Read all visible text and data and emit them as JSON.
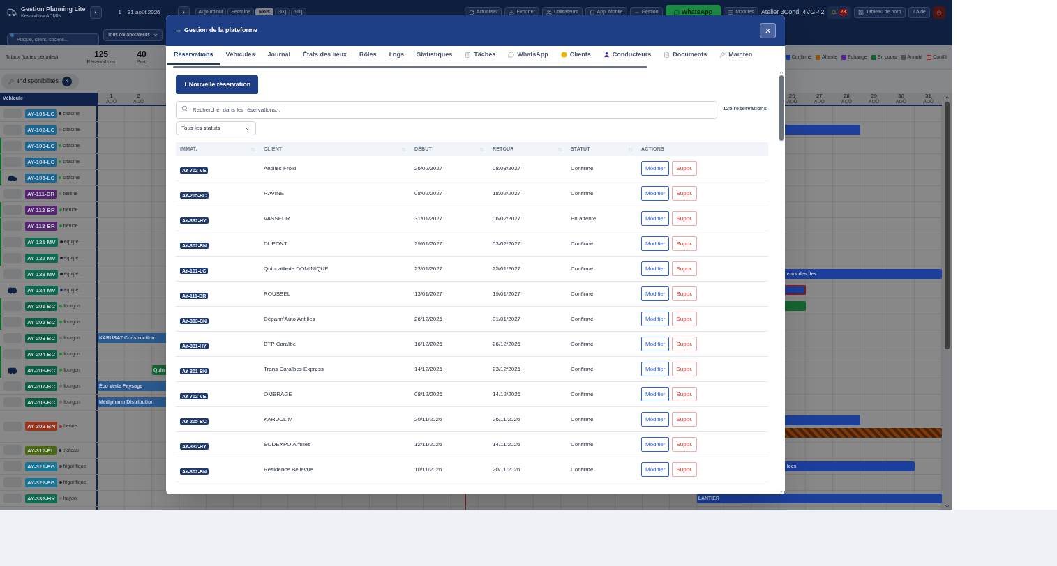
{
  "app": {
    "title": "Gestion Planning Lite",
    "subtitle": "Kesandlow ADMIN",
    "period": "1 – 31 août 2026",
    "prev": "‹",
    "next": "›",
    "views": [
      {
        "label": "Aujourd'hui",
        "selected": false
      },
      {
        "label": "Semaine",
        "selected": false
      },
      {
        "label": "Mois",
        "selected": true
      },
      {
        "label": "30 j",
        "selected": false
      },
      {
        "label": "90 j",
        "selected": false
      }
    ],
    "actions": [
      {
        "kind": "refresh",
        "label": "Actualiser"
      },
      {
        "kind": "export",
        "label": "Exporter"
      },
      {
        "kind": "users",
        "label": "Utilisateurs"
      },
      {
        "kind": "mobile",
        "label": "App. Mobile"
      },
      {
        "kind": "manage",
        "label": "Gestion"
      },
      {
        "kind": "whatsapp",
        "label": "WhatsApp"
      },
      {
        "kind": "modules",
        "label": "Modules"
      }
    ],
    "workshop": "Atelier 3Cond. 4VGP 2",
    "notifications": "28",
    "dashboard": "Tableau de bord",
    "help": "? Aide",
    "search_placeholder": "Plaque, client, société...",
    "collaborators": "Tous collaborateurs",
    "totals_label": "Totaux (toutes périodes)",
    "stats": [
      {
        "value": "125",
        "label": "Réservations"
      },
      {
        "value": "40",
        "label": "Parc"
      }
    ],
    "legend": [
      {
        "label": "Confirmé",
        "color": "#1a3c8c",
        "kind": "fill"
      },
      {
        "label": "Attente",
        "color": "#8a5210",
        "kind": "fill"
      },
      {
        "label": "Echange",
        "color": "#52268f",
        "kind": "fill"
      },
      {
        "label": "En cours",
        "color": "#13602c",
        "kind": "fill"
      },
      {
        "label": "Annulé",
        "color": "#505050",
        "kind": "fill"
      },
      {
        "label": "Conflit",
        "color": "#a01c1c",
        "kind": "outline"
      }
    ],
    "unavailability": {
      "label": "Indisponibilités",
      "count": "9"
    },
    "vehicle_heading": "Véhicule",
    "days_first": [
      {
        "label": "1",
        "month": "AOÛ"
      },
      {
        "label": "2",
        "month": "AOÛ"
      }
    ],
    "days_last": [
      {
        "label": "26",
        "month": "AOÛ"
      },
      {
        "label": "27",
        "month": "AOÛ"
      },
      {
        "label": "28",
        "month": "AOÛ"
      },
      {
        "label": "29",
        "month": "AOÛ"
      },
      {
        "label": "30",
        "month": "AOÛ"
      },
      {
        "label": "31",
        "month": "AOÛ"
      }
    ],
    "vehicles": [
      {
        "plate": "AY-101-LC",
        "category": "citadine",
        "color": "#1d6591",
        "status": {
          "color": "#101a2e"
        },
        "active": false,
        "kind": "none"
      },
      {
        "plate": "AY-102-LC",
        "category": "citadine",
        "color": "#1d6591",
        "status": {
          "color": "#6b6b6b"
        },
        "active": false,
        "kind": "none",
        "bookings": [
          {
            "color": "#1c3f9c",
            "kind": "solid",
            "conflict": false
          }
        ]
      },
      {
        "plate": "AY-103-LC",
        "category": "citadine",
        "color": "#1d6591",
        "status": {
          "color": "#128a3a"
        },
        "active": true,
        "kind": "none"
      },
      {
        "plate": "AY-104-LC",
        "category": "citadine",
        "color": "#1d6591",
        "status": {
          "color": "#128a3a"
        },
        "active": true,
        "kind": "none"
      },
      {
        "plate": "AY-105-LC",
        "category": "citadine",
        "color": "#1d6591",
        "status": {
          "color": "#128a3a"
        },
        "active": true,
        "kind": "car"
      },
      {
        "plate": "AY-111-BR",
        "category": "berline",
        "color": "#55236f",
        "status": {
          "color": "#6b6b6b"
        },
        "active": false,
        "kind": "none"
      },
      {
        "plate": "AY-112-BR",
        "category": "berline",
        "color": "#55236f",
        "status": {
          "color": "#128a3a"
        },
        "active": true,
        "kind": "none"
      },
      {
        "plate": "AY-113-BR",
        "category": "berline",
        "color": "#55236f",
        "status": {
          "color": "#128a3a"
        },
        "active": true,
        "kind": "none"
      },
      {
        "plate": "AY-121-MV",
        "category": "équipé…",
        "color": "#0d6a50",
        "status": {
          "color": "#101a2e"
        },
        "active": true,
        "kind": "none"
      },
      {
        "plate": "AY-122-MV",
        "category": "équipé…",
        "color": "#0d6a50",
        "status": {
          "color": "#101a2e"
        },
        "active": true,
        "kind": "none"
      },
      {
        "plate": "AY-123-MV",
        "category": "équipé…",
        "color": "#0d6a50",
        "status": {
          "color": "#101a2e"
        },
        "active": false,
        "kind": "none",
        "bookings": [
          {
            "color": "#1c3f9c",
            "kind": "solid",
            "conflict": false,
            "continued": true,
            "label": "eurs des Îles"
          }
        ]
      },
      {
        "plate": "AY-124-MV",
        "category": "équipé…",
        "color": "#0d6a50",
        "status": {
          "color": "#1a2f6a"
        },
        "active": false,
        "kind": "van",
        "bookings": [
          {
            "color": "#1c3f9c",
            "kind": "solid",
            "conflict": true
          }
        ]
      },
      {
        "plate": "AY-201-BC",
        "category": "fourgon",
        "color": "#0c5e45",
        "status": {
          "color": "#128a3a"
        },
        "active": true,
        "kind": "none",
        "bookings": [
          {
            "color": "#14652f",
            "kind": "solid",
            "conflict": false
          }
        ]
      },
      {
        "plate": "AY-202-BC",
        "category": "fourgon",
        "color": "#0c5e45",
        "status": {
          "color": "#128a3a"
        },
        "active": true,
        "kind": "none"
      },
      {
        "plate": "AY-203-BC",
        "category": "fourgon",
        "color": "#0c5e45",
        "status": {
          "color": "#6b6b6b"
        },
        "active": false,
        "kind": "none",
        "bookings": [
          {
            "color": "#2a5a8f",
            "kind": "solid",
            "conflict": false,
            "continued": false,
            "label": "KARUBAT Construction"
          }
        ]
      },
      {
        "plate": "AY-204-BC",
        "category": "fourgon",
        "color": "#0c5e45",
        "status": {
          "color": "#128a3a"
        },
        "active": true,
        "kind": "none"
      },
      {
        "plate": "AY-206-BC",
        "category": "fourgon",
        "color": "#0c5e45",
        "status": {
          "color": "#128a3a"
        },
        "active": true,
        "kind": "van",
        "bookings": [
          {
            "color": "#14652f",
            "kind": "solid",
            "conflict": false,
            "continued": false,
            "label": "Quin"
          }
        ]
      },
      {
        "plate": "AY-207-BC",
        "category": "fourgon",
        "color": "#0c5e45",
        "status": {
          "color": "#6b6b6b"
        },
        "active": false,
        "kind": "none",
        "bookings": [
          {
            "color": "#2a5a8f",
            "kind": "solid",
            "conflict": false,
            "continued": false,
            "label": "Éco Verte Paysage"
          }
        ]
      },
      {
        "plate": "AY-208-BC",
        "category": "fourgon",
        "color": "#0c5e45",
        "status": {
          "color": "#6b6b6b"
        },
        "active": false,
        "kind": "none",
        "bookings": [
          {
            "color": "#2a5a8f",
            "kind": "solid",
            "conflict": false,
            "continued": false,
            "label": "Médipharm Distribution"
          }
        ]
      },
      {
        "plate": "AY-302-BN",
        "category": "benne",
        "color": "#9c3218",
        "status": {
          "color": "#a32020"
        },
        "active": false,
        "kind": "none",
        "bookings": [
          {
            "color": "#1c3f9c",
            "kind": "solid",
            "conflict": false
          },
          {
            "color": "#7a3a0c",
            "kind": "hatched",
            "conflict": false
          }
        ]
      },
      {
        "plate": "AY-312-PL",
        "category": "plateau",
        "color": "#4a6810",
        "status": {
          "color": "#101a2e"
        },
        "active": false,
        "kind": "none"
      },
      {
        "plate": "AY-321-FG",
        "category": "frigorifique",
        "color": "#177596",
        "status": {
          "color": "#2a3448"
        },
        "active": false,
        "kind": "none",
        "bookings": [
          {
            "color": "#1c3f9c",
            "kind": "solid",
            "conflict": false,
            "continued": true,
            "label": "ices"
          }
        ]
      },
      {
        "plate": "AY-322-FG",
        "category": "frigorifique",
        "color": "#177596",
        "status": {
          "color": "#101a2e"
        },
        "active": false,
        "kind": "none"
      },
      {
        "plate": "AY-332-HY",
        "category": "hayon",
        "color": "#0e6b4f",
        "status": {
          "color": "#6b6b6b"
        },
        "active": false,
        "kind": "none",
        "bookings": [
          {
            "color": "#1c3f9c",
            "kind": "solid",
            "conflict": false,
            "continued": false,
            "label": "LANTIER"
          }
        ]
      }
    ]
  },
  "modal": {
    "title": "Gestion de la plateforme",
    "close": "×",
    "tabs": [
      {
        "label": "Réservations",
        "selected": true,
        "kind": "plain"
      },
      {
        "label": "Véhicules",
        "selected": false,
        "kind": "plain"
      },
      {
        "label": "Journal",
        "selected": false,
        "kind": "plain"
      },
      {
        "label": "États des lieux",
        "selected": false,
        "kind": "plain"
      },
      {
        "label": "Rôles",
        "selected": false,
        "kind": "plain"
      },
      {
        "label": "Logs",
        "selected": false,
        "kind": "plain"
      },
      {
        "label": "Statistiques",
        "selected": false,
        "kind": "plain"
      },
      {
        "label": "Tâches",
        "selected": false,
        "kind": "tasks"
      },
      {
        "label": "WhatsApp",
        "selected": false,
        "kind": "chat"
      },
      {
        "label": "Clients",
        "selected": false,
        "kind": "clients"
      },
      {
        "label": "Conducteurs",
        "selected": false,
        "kind": "drivers"
      },
      {
        "label": "Documents",
        "selected": false,
        "kind": "documents"
      },
      {
        "label": "Mainten",
        "selected": false,
        "kind": "maintenance"
      }
    ],
    "new_button": "+ Nouvelle réservation",
    "search_placeholder": "Rechercher dans les réservations...",
    "count": "125 réservations",
    "status_filter": "Tous les statuts",
    "columns": [
      {
        "label": "IMMAT.",
        "sortable": true
      },
      {
        "label": "CLIENT",
        "sortable": true
      },
      {
        "label": "DÉBUT",
        "sortable": true
      },
      {
        "label": "RETOUR",
        "sortable": true
      },
      {
        "label": "STATUT",
        "sortable": true
      },
      {
        "label": "ACTIONS",
        "sortable": false
      }
    ],
    "rows": [
      {
        "plate": "AY-702-VE",
        "client": "Antilles Froid",
        "start": "26/02/2027",
        "end": "08/03/2027",
        "status": "Confirmé",
        "actions": [
          "Modifier",
          "Suppr."
        ]
      },
      {
        "plate": "AY-205-BC",
        "client": "RAVINE",
        "start": "08/02/2027",
        "end": "18/02/2027",
        "status": "Confirmé",
        "actions": [
          "Modifier",
          "Suppr."
        ]
      },
      {
        "plate": "AY-332-HY",
        "client": "VASSEUR",
        "start": "31/01/2027",
        "end": "06/02/2027",
        "status": "En attente",
        "actions": [
          "Modifier",
          "Suppr."
        ]
      },
      {
        "plate": "AY-302-BN",
        "client": "DUPONT",
        "start": "29/01/2027",
        "end": "03/02/2027",
        "status": "Confirmé",
        "actions": [
          "Modifier",
          "Suppr."
        ]
      },
      {
        "plate": "AY-101-LC",
        "client": "Quincaillerie DOMINIQUE",
        "start": "23/01/2027",
        "end": "25/01/2027",
        "status": "Confirmé",
        "actions": [
          "Modifier",
          "Suppr."
        ]
      },
      {
        "plate": "AY-111-BR",
        "client": "ROUSSEL",
        "start": "13/01/2027",
        "end": "19/01/2027",
        "status": "Confirmé",
        "actions": [
          "Modifier",
          "Suppr."
        ]
      },
      {
        "plate": "AY-303-BN",
        "client": "Dépann'Auto Antilles",
        "start": "26/12/2026",
        "end": "01/01/2027",
        "status": "Confirmé",
        "actions": [
          "Modifier",
          "Suppr."
        ]
      },
      {
        "plate": "AY-331-HY",
        "client": "BTP Caraïbe",
        "start": "16/12/2026",
        "end": "26/12/2026",
        "status": "Confirmé",
        "actions": [
          "Modifier",
          "Suppr."
        ]
      },
      {
        "plate": "AY-301-BN",
        "client": "Trans Caraïbes Express",
        "start": "14/12/2026",
        "end": "23/12/2026",
        "status": "Confirmé",
        "actions": [
          "Modifier",
          "Suppr."
        ]
      },
      {
        "plate": "AY-702-VE",
        "client": "OMBRAGE",
        "start": "08/12/2026",
        "end": "14/12/2026",
        "status": "Confirmé",
        "actions": [
          "Modifier",
          "Suppr."
        ]
      },
      {
        "plate": "AY-205-BC",
        "client": "KARUCLIM",
        "start": "20/11/2026",
        "end": "26/11/2026",
        "status": "Confirmé",
        "actions": [
          "Modifier",
          "Suppr."
        ]
      },
      {
        "plate": "AY-332-HY",
        "client": "SODEXPO Antilles",
        "start": "12/11/2026",
        "end": "14/11/2026",
        "status": "Confirmé",
        "actions": [
          "Modifier",
          "Suppr."
        ]
      },
      {
        "plate": "AY-302-BN",
        "client": "Résidence Bellevue",
        "start": "10/11/2026",
        "end": "20/11/2026",
        "status": "Confirmé",
        "actions": [
          "Modifier",
          "Suppr."
        ]
      }
    ]
  }
}
